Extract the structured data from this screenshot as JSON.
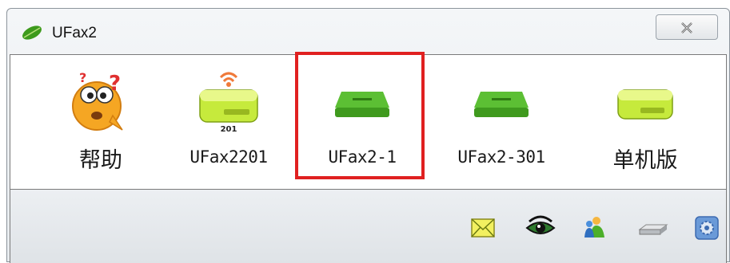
{
  "window": {
    "title": "UFax2",
    "close_glyph": "✕",
    "app_icon": "green-leaf-icon"
  },
  "devices": [
    {
      "label": "帮助",
      "icon": "help-character-icon",
      "selected": false
    },
    {
      "label": "UFax2201",
      "icon": "fax-device-wireless-icon",
      "badge": "201",
      "selected": false
    },
    {
      "label": "UFax2-1",
      "icon": "fax-device-icon",
      "selected": true
    },
    {
      "label": "UFax2-301",
      "icon": "fax-device-icon",
      "selected": false
    },
    {
      "label": "单机版",
      "icon": "standalone-device-icon",
      "selected": false
    }
  ],
  "toolbar": [
    {
      "icon": "envelope-icon"
    },
    {
      "icon": "eye-icon"
    },
    {
      "icon": "users-icon"
    },
    {
      "icon": "drive-icon"
    },
    {
      "icon": "settings-icon"
    }
  ],
  "colors": {
    "selection_border": "#e02020",
    "device_green": "#4caf2a",
    "device_lime": "#b6e23a"
  }
}
